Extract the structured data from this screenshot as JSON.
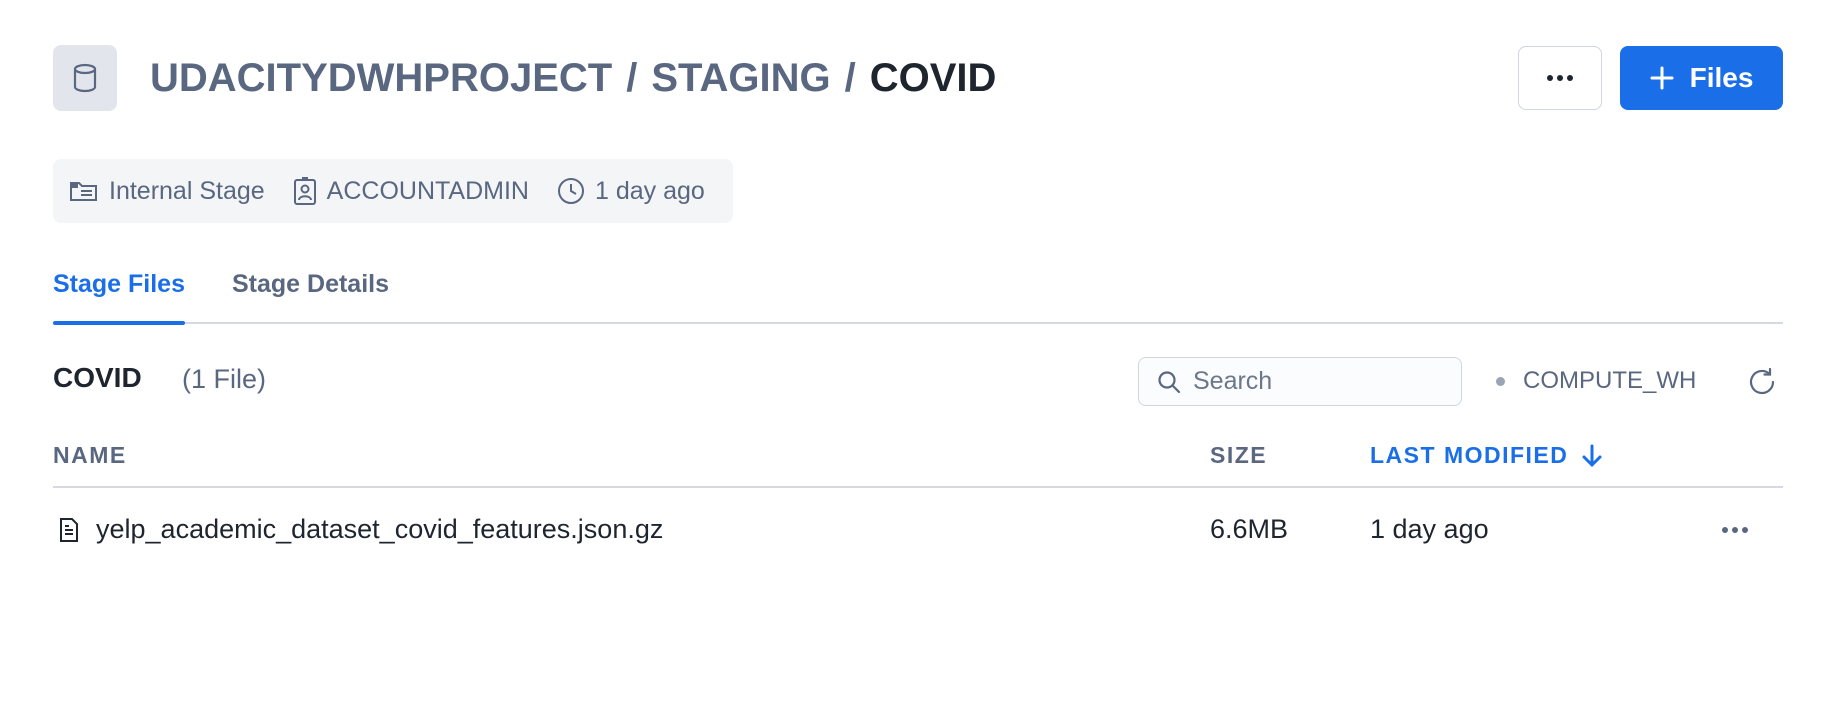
{
  "header": {
    "icon": "database-icon",
    "breadcrumb": [
      "UDACITYDWHPROJECT",
      "STAGING",
      "COVID"
    ],
    "separator": "/",
    "more_icon": "more-horizontal-icon",
    "add_files_label": "Files",
    "add_icon": "plus-icon"
  },
  "meta": {
    "stage_type": "Internal Stage",
    "owner_role": "ACCOUNTADMIN",
    "created": "1 day ago"
  },
  "tabs": [
    {
      "label": "Stage Files",
      "active": true
    },
    {
      "label": "Stage Details",
      "active": false
    }
  ],
  "section": {
    "title": "COVID",
    "count": "(1 File)"
  },
  "search": {
    "placeholder": "Search",
    "value": ""
  },
  "warehouse": {
    "name": "COMPUTE_WH"
  },
  "table": {
    "columns": [
      "NAME",
      "SIZE",
      "LAST MODIFIED"
    ],
    "sorted_column": "LAST MODIFIED",
    "sort_direction": "descending",
    "rows": [
      {
        "name": "yelp_academic_dataset_covid_features.json.gz",
        "size": "6.6MB",
        "modified": "1 day ago"
      }
    ]
  },
  "colors": {
    "accent": "#1a6fe8",
    "text_primary": "#1e252f",
    "text_secondary": "#5a6780"
  }
}
